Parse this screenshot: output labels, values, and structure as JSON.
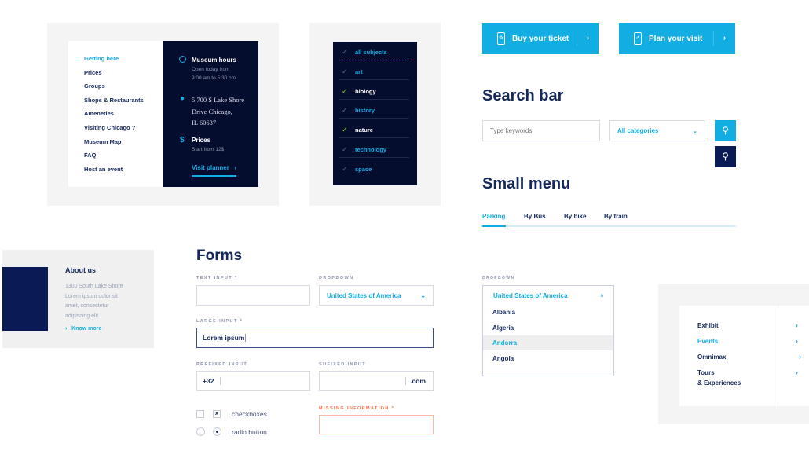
{
  "info_panel": {
    "links": [
      "Getting here",
      "Prices",
      "Groups",
      "Shops & Restaurants",
      "Ameneties",
      "Visiting Chicago ?",
      "Museum Map",
      "FAQ",
      "Host an event"
    ],
    "hours_title": "Museum hours",
    "hours_line1": "Open today from",
    "hours_line2": "9:00 am to 5:30 pm",
    "address": [
      "5 700 S Lake Shore",
      "Drive Chicago,",
      "IL 60637"
    ],
    "prices_title": "Prices",
    "prices_sub": "Start from 12$",
    "visit_planner": "Visit planner"
  },
  "subjects": [
    {
      "label": "all subjects",
      "checked": false
    },
    {
      "label": "art",
      "checked": false
    },
    {
      "label": "biology",
      "checked": true
    },
    {
      "label": "history",
      "checked": false
    },
    {
      "label": "nature",
      "checked": true
    },
    {
      "label": "technology",
      "checked": false
    },
    {
      "label": "space",
      "checked": false
    }
  ],
  "buttons": {
    "buy_ticket": "Buy your ticket",
    "plan_visit": "Plan your visit"
  },
  "search": {
    "heading": "Search bar",
    "placeholder": "Type keywords",
    "category": "All categories"
  },
  "small_menu": {
    "heading": "Small menu",
    "tabs": [
      "Parking",
      "By Bus",
      "By bike",
      "By train"
    ]
  },
  "about": {
    "title": "About us",
    "text": [
      "1300 South Lake Shore",
      "Lorem ipsum dolor sit",
      "amet, consectetur",
      "adipiscing elit."
    ],
    "link": "Know more"
  },
  "forms": {
    "heading": "Forms",
    "text_input_label": "TEXT INPUT *",
    "dropdown_label": "DROPDOWN",
    "dropdown_value": "United States of America",
    "large_input_label": "LARGE INPUT *",
    "large_input_value": "Lorem ipsum",
    "prefixed_label": "PREFIXED INPUT",
    "prefix": "+32",
    "sufixed_label": "SUFIXED INPUT",
    "suffix": ".com",
    "checkboxes_label": "checkboxes",
    "radio_label": "radio button",
    "missing_label": "MISSING INFORMATION *"
  },
  "open_dropdown": {
    "label": "DROPDOWN",
    "value": "United States of America",
    "options": [
      "Albania",
      "Algeria",
      "Andorra",
      "Angola"
    ]
  },
  "mega_menu": {
    "items": [
      "Exhibit",
      "Events",
      "Omnimax",
      "Tours",
      "& Experiences"
    ]
  }
}
